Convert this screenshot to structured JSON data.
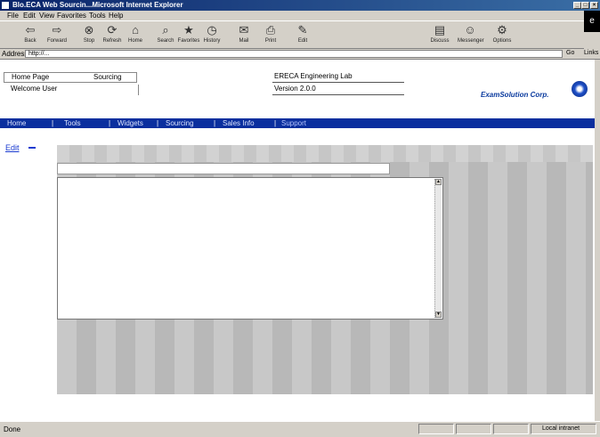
{
  "window": {
    "title": "Blo.ECA Web Sourcin...Microsoft Internet Explorer",
    "min_glyph": "_",
    "max_glyph": "□",
    "close_glyph": "×"
  },
  "menu": [
    "File",
    "Edit",
    "View",
    "Favorites",
    "Tools",
    "Help"
  ],
  "toolbar": [
    {
      "icon": "back-arrow-icon",
      "label": "Back"
    },
    {
      "icon": "forward-arrow-icon",
      "label": "Forward"
    },
    {
      "icon": "stop-icon",
      "label": "Stop"
    },
    {
      "icon": "refresh-icon",
      "label": "Refresh"
    },
    {
      "icon": "home-icon",
      "label": "Home"
    },
    {
      "icon": "search-icon",
      "label": "Search"
    },
    {
      "icon": "favorites-icon",
      "label": "Favorites"
    },
    {
      "icon": "history-icon",
      "label": "History"
    },
    {
      "icon": "mail-icon",
      "label": "Mail"
    },
    {
      "icon": "print-icon",
      "label": "Print"
    },
    {
      "icon": "edit-icon",
      "label": "Edit"
    },
    {
      "icon": "discuss-icon",
      "label": "Discuss"
    },
    {
      "icon": "messenger-icon",
      "label": "Messenger"
    },
    {
      "icon": "options-icon",
      "label": "Options"
    }
  ],
  "address": {
    "label": "Address",
    "url": "http://...",
    "go": "Go",
    "links": "Links"
  },
  "header": {
    "left_row1": "Home Page",
    "left_row1_tag": "Sourcing",
    "left_row2": "Welcome User",
    "right_row1": "ERECA Engineering Lab",
    "right_row2": "Version 2.0.0",
    "logo_text": "ExamSolution Corp."
  },
  "nav": {
    "items": [
      "Home",
      "Tools",
      "Widgets",
      "Sourcing",
      "Sales Info",
      "Support"
    ],
    "active_index": 5
  },
  "sidebar": {
    "link": "Edit"
  },
  "status": {
    "text": "Done",
    "zone": "Local intranet"
  }
}
